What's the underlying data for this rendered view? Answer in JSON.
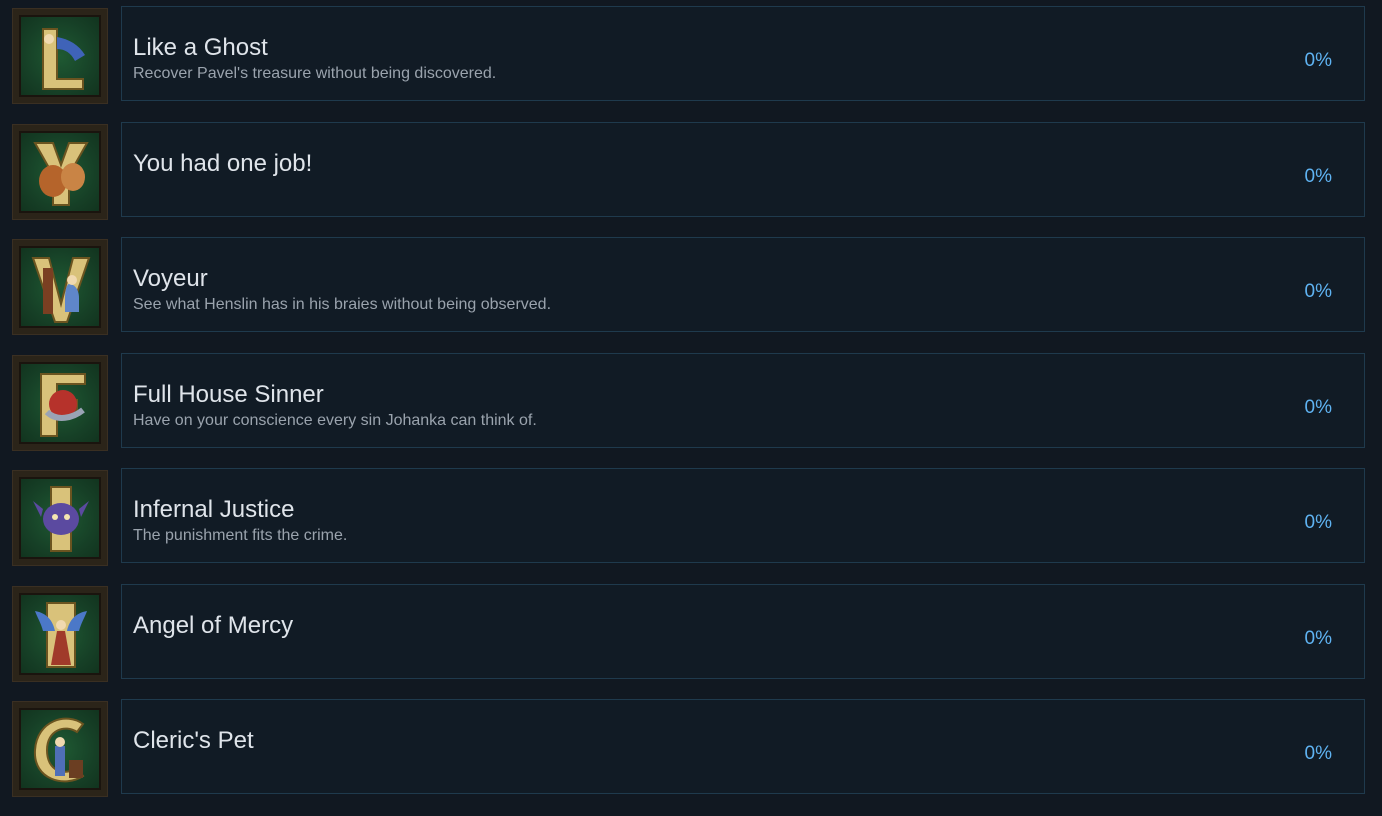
{
  "achievements": [
    {
      "title": "Like a Ghost",
      "description": "Recover Pavel's treasure without being discovered.",
      "percent": "0%",
      "icon": "letter-l-hand-icon"
    },
    {
      "title": "You had one job!",
      "description": "",
      "percent": "0%",
      "icon": "letter-y-jug-icon"
    },
    {
      "title": "Voyeur",
      "description": "See what Henslin has in his braies without being observed.",
      "percent": "0%",
      "icon": "letter-v-figure-icon"
    },
    {
      "title": "Full House Sinner",
      "description": "Have on your conscience every sin Johanka can think of.",
      "percent": "0%",
      "icon": "letter-f-apple-serpent-icon"
    },
    {
      "title": "Infernal Justice",
      "description": "The punishment fits the crime.",
      "percent": "0%",
      "icon": "letter-i-demon-icon"
    },
    {
      "title": "Angel of Mercy",
      "description": "",
      "percent": "0%",
      "icon": "letter-a-angel-icon"
    },
    {
      "title": "Cleric's Pet",
      "description": "",
      "percent": "0%",
      "icon": "letter-c-cleric-icon"
    }
  ]
}
